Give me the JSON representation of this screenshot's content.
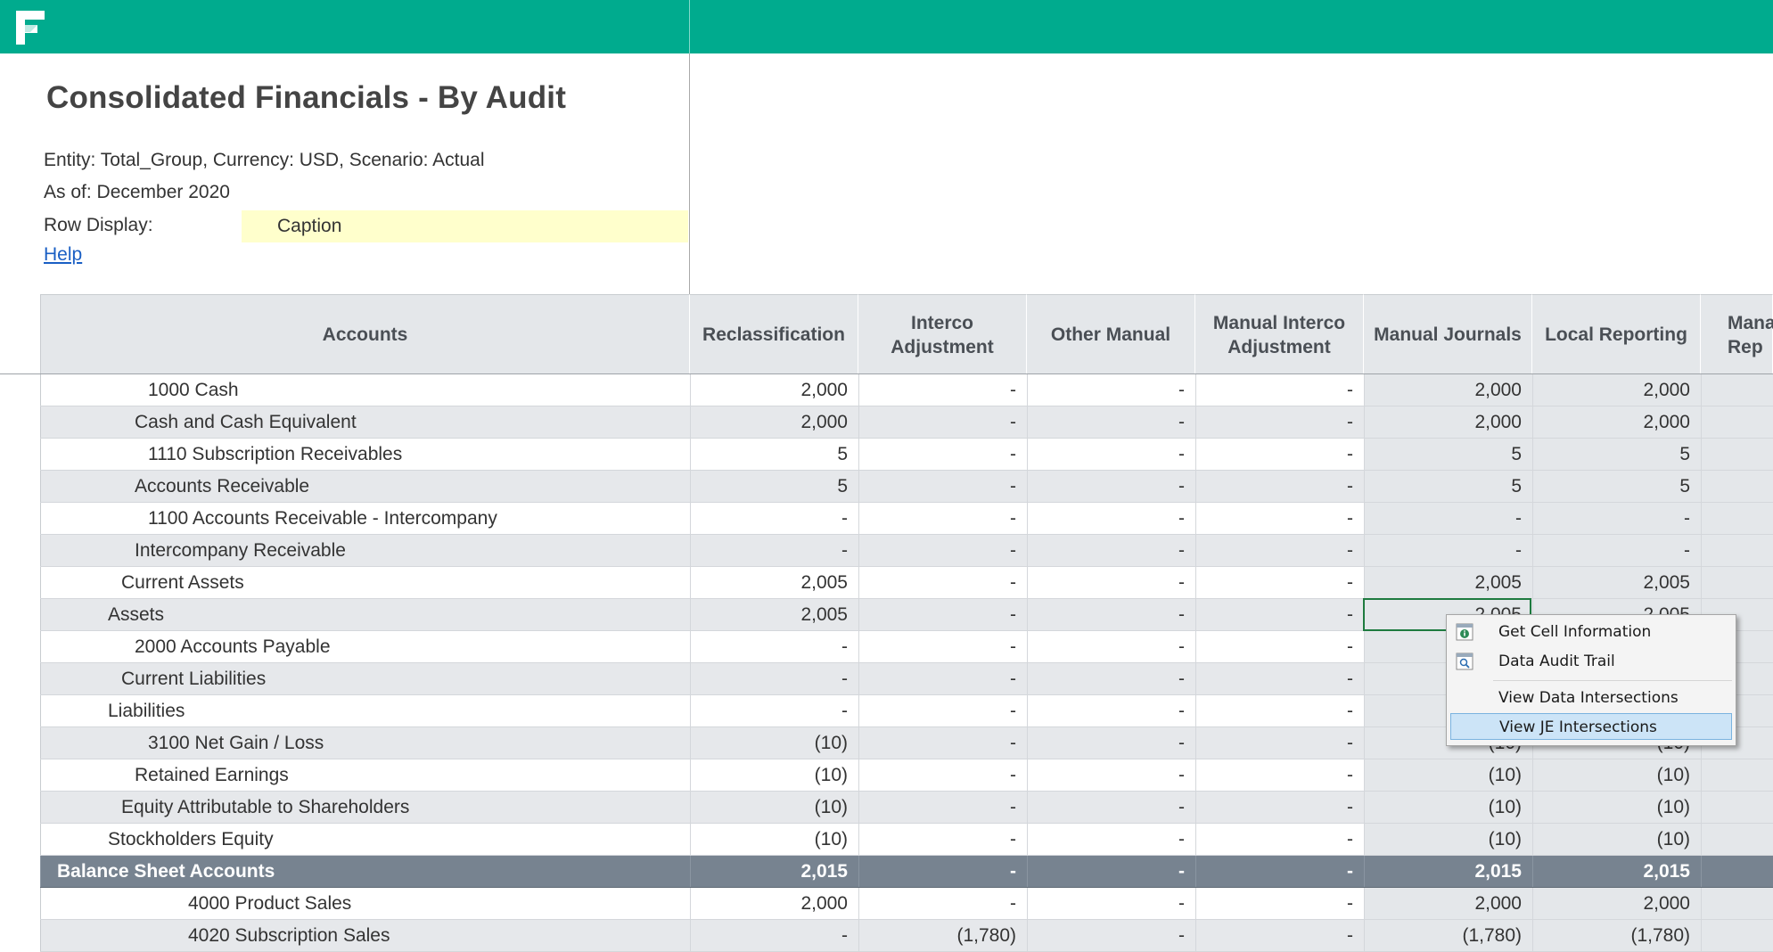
{
  "report": {
    "title": "Consolidated Financials - By Audit",
    "entity_line": "Entity: Total_Group, Currency: USD, Scenario: Actual",
    "as_of_line": "As of: December 2020",
    "row_display_label": "Row Display:",
    "row_display_value": "Caption",
    "help_link": "Help"
  },
  "columns": [
    "Accounts",
    "Reclassification",
    "Interco Adjustment",
    "Other Manual",
    "Manual Interco Adjustment",
    "Manual Journals",
    "Local Reporting",
    "Mana Rep"
  ],
  "rows": [
    {
      "account": "1000 Cash",
      "values": [
        "2,000",
        "-",
        "-",
        "-",
        "2,000",
        "2,000"
      ]
    },
    {
      "account": "Cash and Cash Equivalent",
      "values": [
        "2,000",
        "-",
        "-",
        "-",
        "2,000",
        "2,000"
      ]
    },
    {
      "account": "1110 Subscription Receivables",
      "values": [
        "5",
        "-",
        "-",
        "-",
        "5",
        "5"
      ]
    },
    {
      "account": "Accounts Receivable",
      "values": [
        "5",
        "-",
        "-",
        "-",
        "5",
        "5"
      ]
    },
    {
      "account": "1100 Accounts Receivable - Intercompany",
      "values": [
        "-",
        "-",
        "-",
        "-",
        "-",
        "-"
      ]
    },
    {
      "account": "Intercompany Receivable",
      "values": [
        "-",
        "-",
        "-",
        "-",
        "-",
        "-"
      ]
    },
    {
      "account": "Current Assets",
      "values": [
        "2,005",
        "-",
        "-",
        "-",
        "2,005",
        "2,005"
      ]
    },
    {
      "account": "Assets",
      "values": [
        "2,005",
        "-",
        "-",
        "-",
        "2,005",
        "2,005"
      ]
    },
    {
      "account": "2000 Accounts Payable",
      "values": [
        "-",
        "-",
        "-",
        "-",
        "",
        ""
      ]
    },
    {
      "account": "Current Liabilities",
      "values": [
        "-",
        "-",
        "-",
        "-",
        "",
        ""
      ]
    },
    {
      "account": "Liabilities",
      "values": [
        "-",
        "-",
        "-",
        "-",
        "",
        ""
      ]
    },
    {
      "account": "3100 Net Gain / Loss",
      "values": [
        "(10)",
        "-",
        "-",
        "-",
        "(10)",
        "(10)"
      ]
    },
    {
      "account": "Retained Earnings",
      "values": [
        "(10)",
        "-",
        "-",
        "-",
        "(10)",
        "(10)"
      ]
    },
    {
      "account": "Equity Attributable to Shareholders",
      "values": [
        "(10)",
        "-",
        "-",
        "-",
        "(10)",
        "(10)"
      ]
    },
    {
      "account": "Stockholders Equity",
      "values": [
        "(10)",
        "-",
        "-",
        "-",
        "(10)",
        "(10)"
      ]
    },
    {
      "account": "Balance Sheet Accounts",
      "values": [
        "2,015",
        "-",
        "-",
        "-",
        "2,015",
        "2,015"
      ]
    },
    {
      "account": "4000 Product Sales",
      "values": [
        "2,000",
        "-",
        "-",
        "-",
        "2,000",
        "2,000"
      ]
    },
    {
      "account": "4020 Subscription Sales",
      "values": [
        "-",
        "(1,780)",
        "-",
        "-",
        "(1,780)",
        "(1,780)"
      ]
    }
  ],
  "context_menu": {
    "items": [
      {
        "label": "Get Cell Information",
        "icon": "info-icon"
      },
      {
        "label": "Data Audit Trail",
        "icon": "magnifier-icon"
      },
      {
        "label": "View Data Intersections",
        "icon": ""
      },
      {
        "label": "View JE Intersections",
        "icon": ""
      }
    ],
    "highlighted": "View JE Intersections"
  },
  "colors": {
    "brand": "#00ab8e",
    "total_row": "#778390",
    "row_display_bg": "#ffffcc",
    "selection": "#1e7a3f"
  }
}
